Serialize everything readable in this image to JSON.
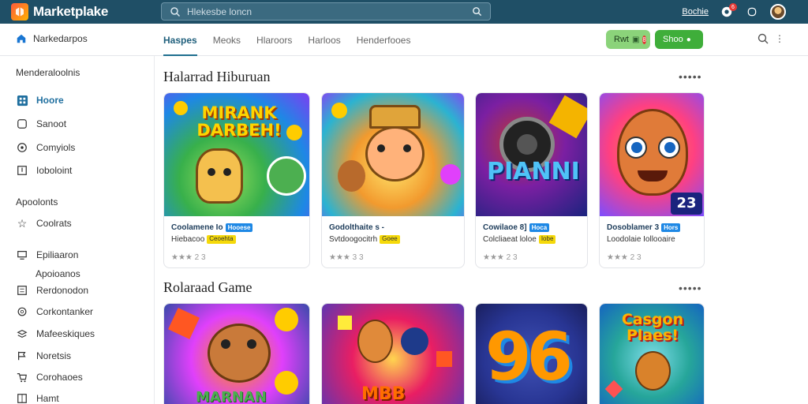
{
  "app": {
    "name": "Marketplake"
  },
  "search": {
    "placeholder": "Hlekesbe loncn"
  },
  "topbar": {
    "link": "Bochie",
    "notif_count": "6"
  },
  "subbar": {
    "home_label": "Narkedarpos",
    "tabs": [
      {
        "label": "Haspes",
        "active": true
      },
      {
        "label": "Meoks"
      },
      {
        "label": "Hlaroors"
      },
      {
        "label": "Harloos"
      },
      {
        "label": "Henderfooes"
      }
    ],
    "btn_light": "Rwt",
    "btn_light_count": "8",
    "btn_dark": "Shoo"
  },
  "sidebar": {
    "heading1": "Menderaloolnis",
    "items1": [
      {
        "label": "Hoore",
        "icon": "grid-icon",
        "active": true
      },
      {
        "label": "Sanoot",
        "icon": "box-icon"
      },
      {
        "label": "Comyiols",
        "icon": "target-icon"
      },
      {
        "label": "Ioboloint",
        "icon": "upload-icon"
      }
    ],
    "heading2": "Apoolonts",
    "items2": [
      {
        "label": "Coolrats",
        "icon": "star-icon"
      },
      {
        "label": "Epiliaaron",
        "icon": "tray-icon"
      }
    ],
    "plain": "Apoioanos",
    "items3": [
      {
        "label": "Rerdonodon",
        "icon": "list-icon"
      },
      {
        "label": "Corkontanker",
        "icon": "gear-icon"
      },
      {
        "label": "Mafeeskiques",
        "icon": "layers-icon"
      },
      {
        "label": "Noretsis",
        "icon": "flag-icon"
      },
      {
        "label": "Corohaoes",
        "icon": "cart-icon"
      },
      {
        "label": "Hamt",
        "icon": "grid-icon"
      }
    ]
  },
  "sections": [
    {
      "title": "Halarrad Hiburuan",
      "more": "•••••",
      "cards": [
        {
          "thumb_text": "MIRANK DARBEH!",
          "title": "Coolamene Io",
          "tag": "Hooese",
          "sub": "Hiebacoo",
          "sub_tag": "Ceoehta",
          "rating": "★★★ 2 3"
        },
        {
          "thumb_text": "",
          "title": "Godolthaite s -",
          "tag": "",
          "sub": "Svtdoogocitrh",
          "sub_tag": "Goee",
          "rating": "★★★ 3 3"
        },
        {
          "thumb_text": "PIANNI",
          "title": "Cowilaoe 8]",
          "tag": "Hoca",
          "sub": "Colcliaeat loloe",
          "sub_tag": "Iobe",
          "rating": "★★★ 2 3"
        },
        {
          "thumb_text": "23",
          "title": "Dosoblamer 3",
          "tag": "Hors",
          "sub": "Loodolaie Iollooaire",
          "sub_tag": "",
          "rating": "★★★ 2 3"
        }
      ]
    },
    {
      "title": "Rolaraad Game",
      "more": "•••••",
      "cards": [
        {
          "thumb_text": "MARNAN"
        },
        {
          "thumb_text": "MBB"
        },
        {
          "thumb_text": "96"
        },
        {
          "thumb_text": "Casgon Plaes!"
        }
      ]
    }
  ]
}
